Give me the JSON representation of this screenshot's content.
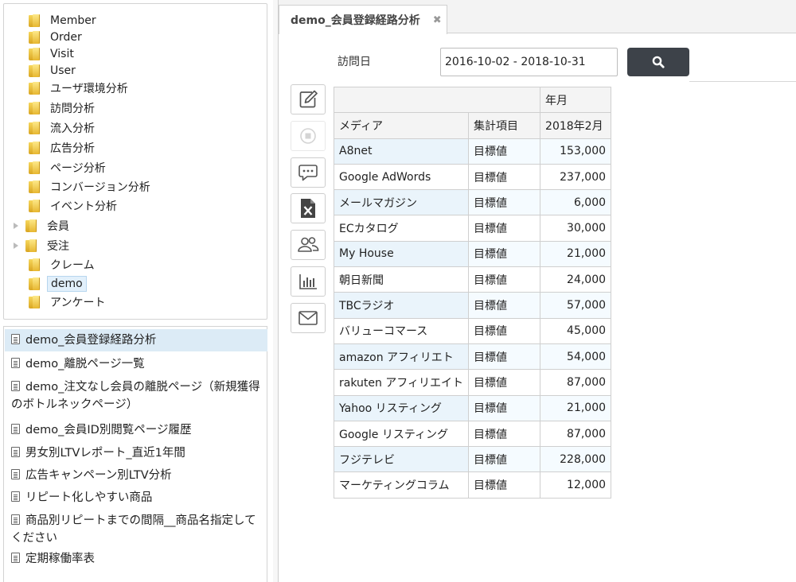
{
  "tree": {
    "items": [
      {
        "label": "Member",
        "expandable": false,
        "selected": false
      },
      {
        "label": "Order",
        "expandable": false,
        "selected": false
      },
      {
        "label": "Visit",
        "expandable": false,
        "selected": false
      },
      {
        "label": "User",
        "expandable": false,
        "selected": false
      },
      {
        "label": "ユーザ環境分析",
        "expandable": false,
        "selected": false
      },
      {
        "label": "訪問分析",
        "expandable": false,
        "selected": false
      },
      {
        "label": "流入分析",
        "expandable": false,
        "selected": false
      },
      {
        "label": "広告分析",
        "expandable": false,
        "selected": false
      },
      {
        "label": "ページ分析",
        "expandable": false,
        "selected": false
      },
      {
        "label": "コンバージョン分析",
        "expandable": false,
        "selected": false
      },
      {
        "label": "イベント分析",
        "expandable": false,
        "selected": false
      },
      {
        "label": "会員",
        "expandable": true,
        "selected": false
      },
      {
        "label": "受注",
        "expandable": true,
        "selected": false
      },
      {
        "label": "クレーム",
        "expandable": false,
        "selected": false
      },
      {
        "label": "demo",
        "expandable": false,
        "selected": true
      },
      {
        "label": "アンケート",
        "expandable": false,
        "selected": false
      }
    ]
  },
  "reports": {
    "items": [
      {
        "label": "demo_会員登録経路分析",
        "selected": true
      },
      {
        "label": "demo_離脱ページ一覧",
        "selected": false
      },
      {
        "label": "demo_注文なし会員の離脱ページ（新規獲得のボトルネックページ）",
        "selected": false
      },
      {
        "label": "demo_会員ID別閲覧ページ履歴",
        "selected": false
      },
      {
        "label": "男女別LTVレポート_直近1年間",
        "selected": false
      },
      {
        "label": "広告キャンペーン別LTV分析",
        "selected": false
      },
      {
        "label": "リピート化しやすい商品",
        "selected": false
      },
      {
        "label": "商品別リピートまでの間隔__商品名指定してください",
        "selected": false
      },
      {
        "label": "定期稼働率表",
        "selected": false
      }
    ]
  },
  "tab": {
    "title": "demo_会員登録経路分析",
    "close": "✖"
  },
  "filter": {
    "label": "訪問日",
    "date_range": "2016-10-02 - 2018-10-31"
  },
  "toolbar": {
    "buttons": [
      {
        "name": "edit-button",
        "icon": "edit-icon",
        "enabled": true
      },
      {
        "name": "stop-button",
        "icon": "stop-icon",
        "enabled": false
      },
      {
        "name": "comment-button",
        "icon": "comment-icon",
        "enabled": true
      },
      {
        "name": "excel-export-button",
        "icon": "excel-icon",
        "enabled": true
      },
      {
        "name": "users-button",
        "icon": "users-icon",
        "enabled": true
      },
      {
        "name": "chart-button",
        "icon": "bar-chart-icon",
        "enabled": true
      },
      {
        "name": "mail-button",
        "icon": "mail-icon",
        "enabled": true
      }
    ]
  },
  "table": {
    "col_group_header": "年月",
    "headers": [
      "メディア",
      "集計項目",
      "2018年2月"
    ],
    "rows": [
      {
        "media": "A8net",
        "item": "目標値",
        "value": "153,000"
      },
      {
        "media": "Google AdWords",
        "item": "目標値",
        "value": "237,000"
      },
      {
        "media": "メールマガジン",
        "item": "目標値",
        "value": "6,000"
      },
      {
        "media": "ECカタログ",
        "item": "目標値",
        "value": "30,000"
      },
      {
        "media": "My House",
        "item": "目標値",
        "value": "21,000"
      },
      {
        "media": "朝日新聞",
        "item": "目標値",
        "value": "24,000"
      },
      {
        "media": "TBCラジオ",
        "item": "目標値",
        "value": "57,000"
      },
      {
        "media": "バリューコマース",
        "item": "目標値",
        "value": "45,000"
      },
      {
        "media": "amazon アフィリエト",
        "item": "目標値",
        "value": "54,000"
      },
      {
        "media": "rakuten アフィリエイト",
        "item": "目標値",
        "value": "87,000"
      },
      {
        "media": "Yahoo リスティング",
        "item": "目標値",
        "value": "21,000"
      },
      {
        "media": "Google リスティング",
        "item": "目標値",
        "value": "87,000"
      },
      {
        "media": "フジテレビ",
        "item": "目標値",
        "value": "228,000"
      },
      {
        "media": "マーケティングコラム",
        "item": "目標値",
        "value": "12,000"
      }
    ]
  },
  "colors": {
    "accent": "#3d4249",
    "selected_bg": "#dcebf6",
    "row_alt_bg": "#eaf4fb"
  }
}
